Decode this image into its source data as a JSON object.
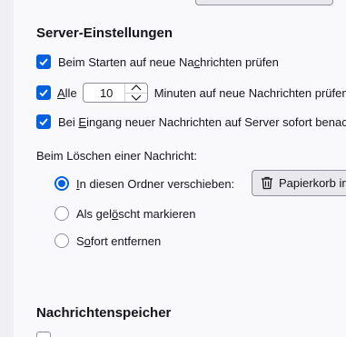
{
  "server_settings": {
    "title": "Server-Einstellungen",
    "check_on_startup": {
      "label_before": "Beim Starten auf neue Na",
      "mnemonic": "c",
      "label_after": "hrichten prüfen",
      "checked": true
    },
    "check_every": {
      "label_before": "",
      "mnemonic": "A",
      "label_after": "lle",
      "value": "10",
      "suffix": "Minuten auf neue Nachrichten prüfen",
      "checked": true
    },
    "fetch_on_arrival": {
      "label_before": "Bei ",
      "mnemonic": "E",
      "label_after": "ingang neuer Nachrichten auf Server sofort benachrichtigen",
      "checked": true
    },
    "on_delete_label": "Beim Löschen einer Nachricht:",
    "delete_options": {
      "move": {
        "label_before": "",
        "mnemonic": "I",
        "label_after": "n diesen Ordner verschieben:",
        "selected": true
      },
      "mark": {
        "label_before": "Als gel",
        "mnemonic": "ö",
        "label_after": "scht markieren",
        "selected": false
      },
      "remove": {
        "label_before": "S",
        "mnemonic": "o",
        "label_after": "fort entfernen",
        "selected": false
      }
    },
    "folder_button": {
      "icon": "trash-icon",
      "label": "Papierkorb in"
    }
  },
  "message_storage": {
    "title": "Nachrichtenspeicher"
  },
  "colors": {
    "accent": "#0061e0",
    "panel": "#f9f9fb",
    "sidebar": "#f0f0f4"
  }
}
